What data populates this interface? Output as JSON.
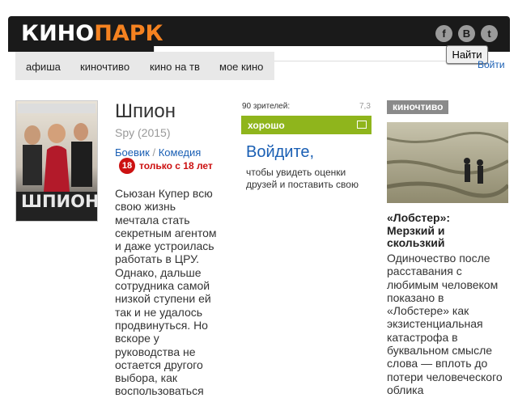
{
  "header": {
    "logo_part1": "КИНО",
    "logo_part2": "ПАРК",
    "social": [
      {
        "icon": "facebook-icon",
        "glyph": "f"
      },
      {
        "icon": "vk-icon",
        "glyph": "B"
      },
      {
        "icon": "twitter-icon",
        "glyph": "t"
      }
    ],
    "search_button": "Найти",
    "login_link": "Войти",
    "colors": {
      "bar": "#1a1a1a",
      "logo_accent": "#f58220"
    }
  },
  "nav": {
    "items": [
      "афиша",
      "киночтиво",
      "кино на тв",
      "мое кино"
    ]
  },
  "movie": {
    "title": "Шпион",
    "original": "Spy (2015)",
    "genres": [
      "Боевик",
      "Комедия"
    ],
    "genre_sep": " / ",
    "age": "18",
    "age_text": "только с 18 лет",
    "description": "Сьюзан Купер всю свою жизнь мечтала стать секретным агентом и даже устроилась работать в ЦРУ. Однако, дальше сотрудника самой низкой ступени ей так и не удалось продвинуться. Но вскоре у руководства не остается другого выбора, как воспользоваться",
    "poster_title": "ШПИОН"
  },
  "rating": {
    "viewers": "90 зрителей:",
    "score": "7,3",
    "label": "хорошо",
    "color": "#8fb51c"
  },
  "login_prompt": {
    "title": "Войдите,",
    "subtitle": "чтобы увидеть оценки друзей и поставить свою"
  },
  "sidebar": {
    "tag": "киночтиво",
    "article_title": "«Лобстер»: Мерзкий и скользкий",
    "article_text": "Одиночество после расставания с любимым человеком показано в «Лобстере» как экзистенциальная катастрофа в буквальном смысле слова — вплоть до потери человеческого облика"
  }
}
